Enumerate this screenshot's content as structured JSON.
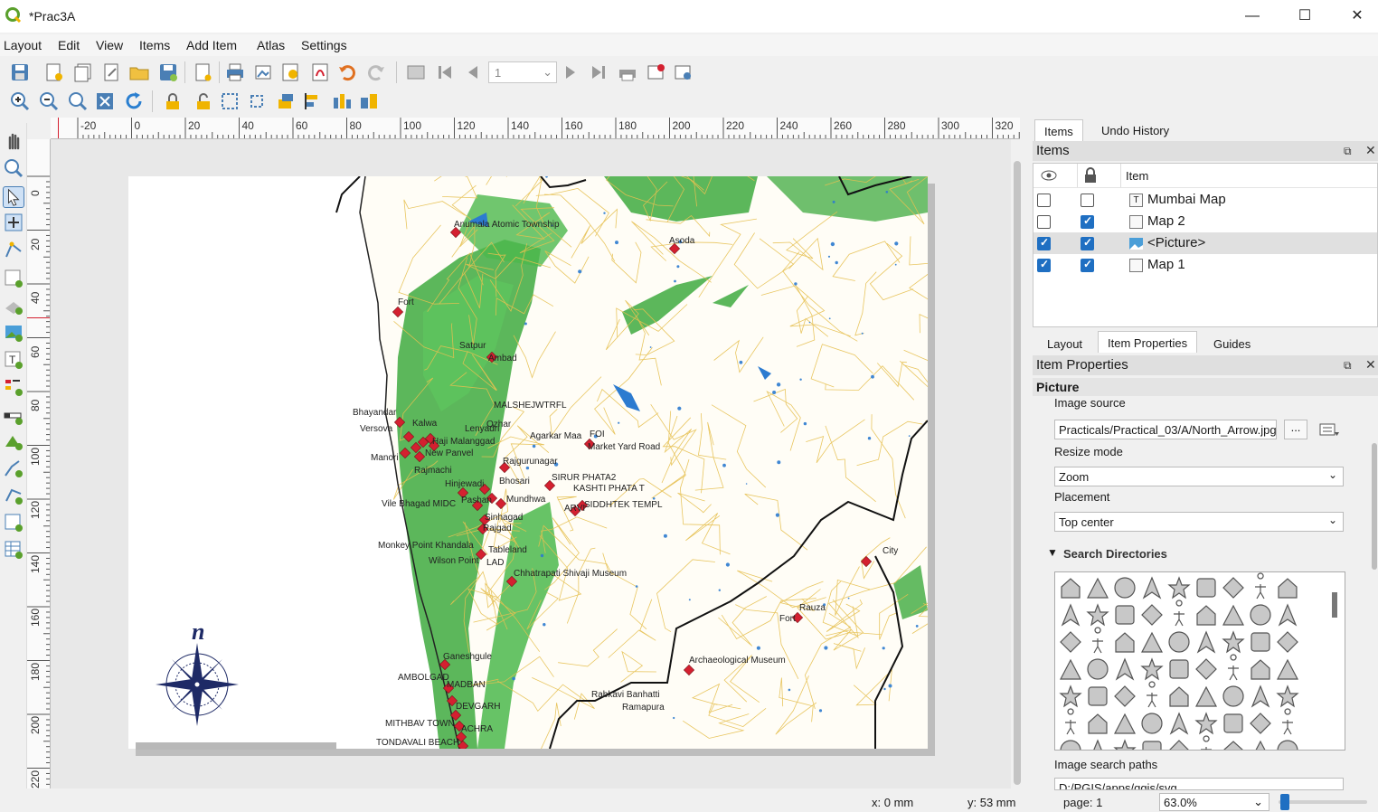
{
  "window": {
    "title": "*Prac3A",
    "minimize": "—",
    "maximize": "☐",
    "close": "✕"
  },
  "menu": [
    "Layout",
    "Edit",
    "View",
    "Items",
    "Add Item",
    "Atlas",
    "Settings"
  ],
  "atlas": {
    "page_value": "1"
  },
  "ruler": {
    "top_ticks": [
      "-20",
      "0",
      "20",
      "40",
      "60",
      "80",
      "100",
      "120",
      "140",
      "160",
      "180",
      "200",
      "220",
      "240",
      "260",
      "280",
      "300",
      "320"
    ],
    "left_ticks": [
      "0",
      "20",
      "40",
      "60",
      "80",
      "100",
      "120",
      "140",
      "160",
      "180",
      "200",
      "220"
    ]
  },
  "map": {
    "labels": [
      "Anumala Atomic Township",
      "Asoda",
      "Fort",
      "Satpur",
      "Ambad",
      "Bhayandar",
      "Kalwa",
      "Versova",
      "Ozhar",
      "MALSHEJWTRFL",
      "Lenyadri",
      "Agarkar Maa",
      "FOI",
      "Market Yard Road",
      "Haji Malanggad",
      "New Panvel",
      "Manori",
      "Rajgurunagar",
      "Rajmachi",
      "SIRUR PHATA2",
      "KASHTI PHATA T",
      "Hinjewadi",
      "Bhosari",
      "Pashan",
      "Mundhwa",
      "ARVI",
      "SIDDHTEK TEMPL",
      "Vile Bhagad MIDC",
      "Sinhagad",
      "Rajgad",
      "Monkey Point Khandala",
      "Tableland",
      "Wilson Point",
      "LAD",
      "Chhatrapati Shivaji Museum",
      "City",
      "Rauza",
      "Fort",
      "Ganeshgule",
      "Archaeological Museum",
      "AMBOLGAD",
      "MADBAN",
      "DEVGARH",
      "Rabkavi Banhatti",
      "Ramapura",
      "MITHBAV TOWN",
      "ACHRA",
      "TONDAVALI BEACH"
    ],
    "north_arrow_letter": "n"
  },
  "dock": {
    "top_tabs": [
      "Items",
      "Undo History"
    ],
    "items_title": "Items",
    "items_header": "Item",
    "items": [
      {
        "label": "Mumbai Map",
        "visible": false,
        "locked": false,
        "type": "T"
      },
      {
        "label": "Map 2",
        "visible": false,
        "locked": true,
        "type": "map"
      },
      {
        "label": "<Picture>",
        "visible": true,
        "locked": true,
        "type": "picture"
      },
      {
        "label": "Map 1",
        "visible": true,
        "locked": true,
        "type": "map"
      }
    ],
    "bottom_tabs": [
      "Layout",
      "Item Properties",
      "Guides"
    ],
    "props_title": "Item Properties",
    "props_section": "Picture",
    "image_source_label": "Image source",
    "image_source_value": "Practicals/Practical_03/A/North_Arrow.jpg",
    "browse": "...",
    "resize_label": "Resize mode",
    "resize_value": "Zoom",
    "placement_label": "Placement",
    "placement_value": "Top center",
    "search_dirs": "Search Directories",
    "search_paths_label": "Image search paths",
    "search_paths_value": "D:/PGIS/apps/qgis/svg"
  },
  "status": {
    "x": "x: 0 mm",
    "y": "y: 53 mm",
    "page": "page: 1",
    "zoom": "63.0%"
  },
  "colors": {
    "accent": "#1f6fc2",
    "forest": "#3faa3f",
    "marker": "#d42030",
    "roads": "#e6c050"
  }
}
